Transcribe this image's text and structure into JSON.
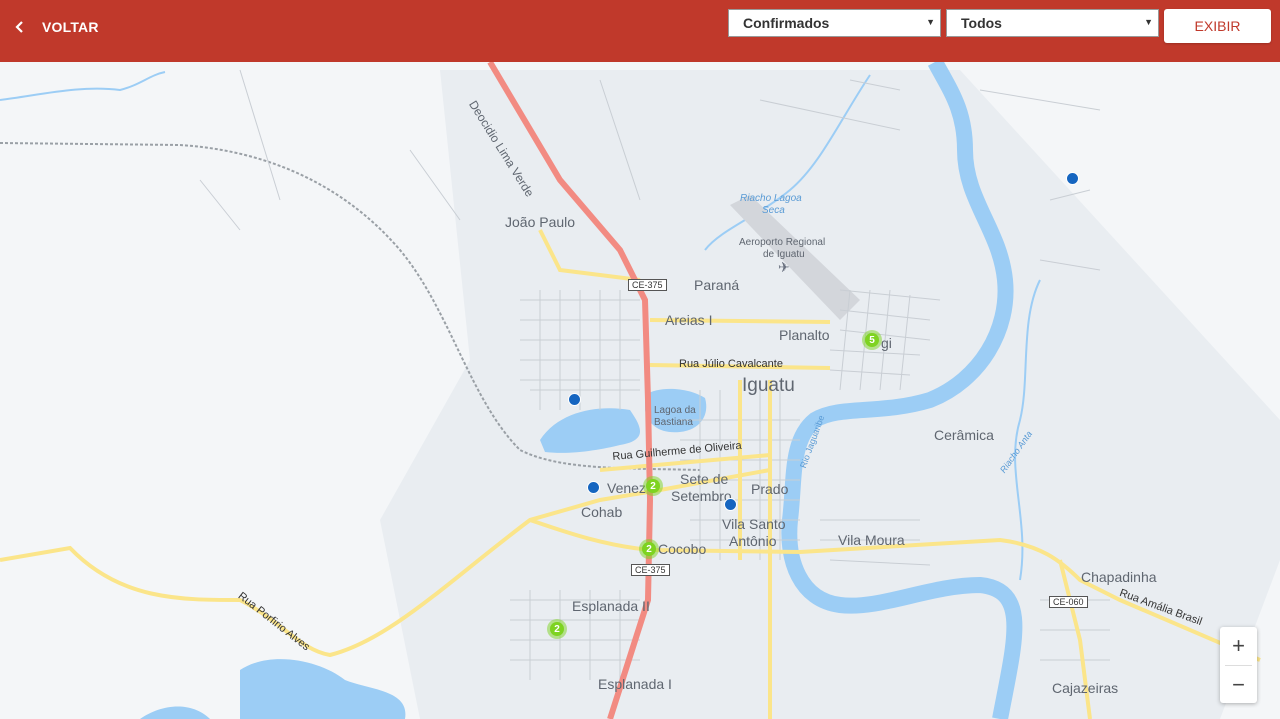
{
  "header": {
    "back_label": "VOLTAR",
    "filter_status": {
      "selected": "Confirmados"
    },
    "filter_scope": {
      "selected": "Todos"
    },
    "submit_label": "EXIBIR"
  },
  "map": {
    "city_label": "Iguatu",
    "places": [
      "João Paulo",
      "Paraná",
      "Areias I",
      "Planalto",
      "Cerâmica",
      "Sete de",
      "Setembro",
      "Prado",
      "Vila Santo",
      "Antônio",
      "Vila Moura",
      "Chapadinha",
      "Cohab",
      "Cocobo",
      "Esplanada II",
      "Esplanada I",
      "Cajazeiras",
      "Venez",
      "Lagoa da",
      "Bastiana",
      "Aeroporto Regional",
      "de Iguatu",
      "Riacho Lagoa",
      "Seca",
      "gi"
    ],
    "roads": [
      "Deocidio Lima Verde",
      "Rua Júlio Cavalcante",
      "Rua Guilherme de Oliveira",
      "Rua Porfirio Alves",
      "Rua Amália Brasil",
      "Rio Jaguaribe",
      "Riacho Anta"
    ],
    "shields": [
      "CE-375",
      "CE-375",
      "CE-060"
    ],
    "clusters": [
      {
        "count": "5"
      },
      {
        "count": "2"
      },
      {
        "count": "2"
      },
      {
        "count": "2"
      }
    ],
    "single_points": 4
  },
  "zoom": {
    "in": "+",
    "out": "−"
  },
  "colors": {
    "brand": "#c0392b",
    "cluster": "#7ed321",
    "point": "#1565c0",
    "water": "#9ccdf5",
    "road_main": "#f28b82",
    "road_yellow": "#fbe58a"
  }
}
